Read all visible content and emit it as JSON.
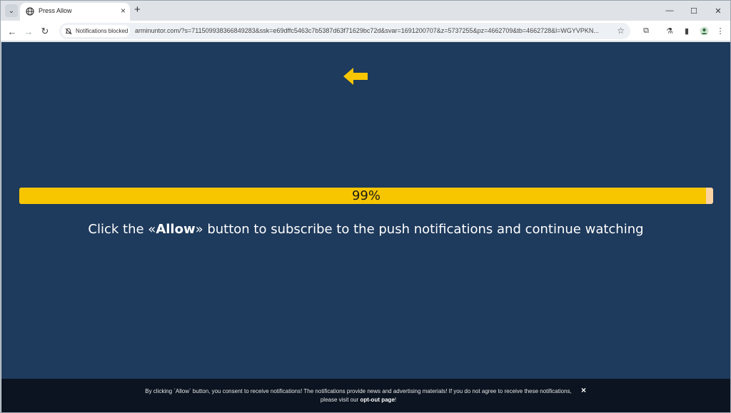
{
  "browser": {
    "tab": {
      "title": "Press Allow",
      "favicon": "globe-icon"
    },
    "omnibox": {
      "notification_chip": "Notifications blocked",
      "url": "arminuntor.com/?s=711509938366849283&ssk=e69dffc5463c7b5387d63f71629bc72d&svar=1691200707&z=5737255&pz=4662709&tb=4662728&l=WGYVPKN..."
    }
  },
  "page": {
    "progress": {
      "label": "99%",
      "percent": 99
    },
    "message": {
      "prefix": "Click the «",
      "emphasis": "Allow",
      "suffix": "» button to subscribe to the push notifications and continue watching"
    }
  },
  "footer": {
    "text": "By clicking `Allow` button, you consent to receive notifications! The notifications provide news and advertising materials! If you do not agree to receive these notifications, please visit our ",
    "link": "opt-out page",
    "after_link": "!",
    "close": "×"
  },
  "colors": {
    "page_background": "#1e3a5c",
    "progress_fill": "#f7c600",
    "arrow": "#f7c600",
    "footer_background": "#0b1420"
  }
}
